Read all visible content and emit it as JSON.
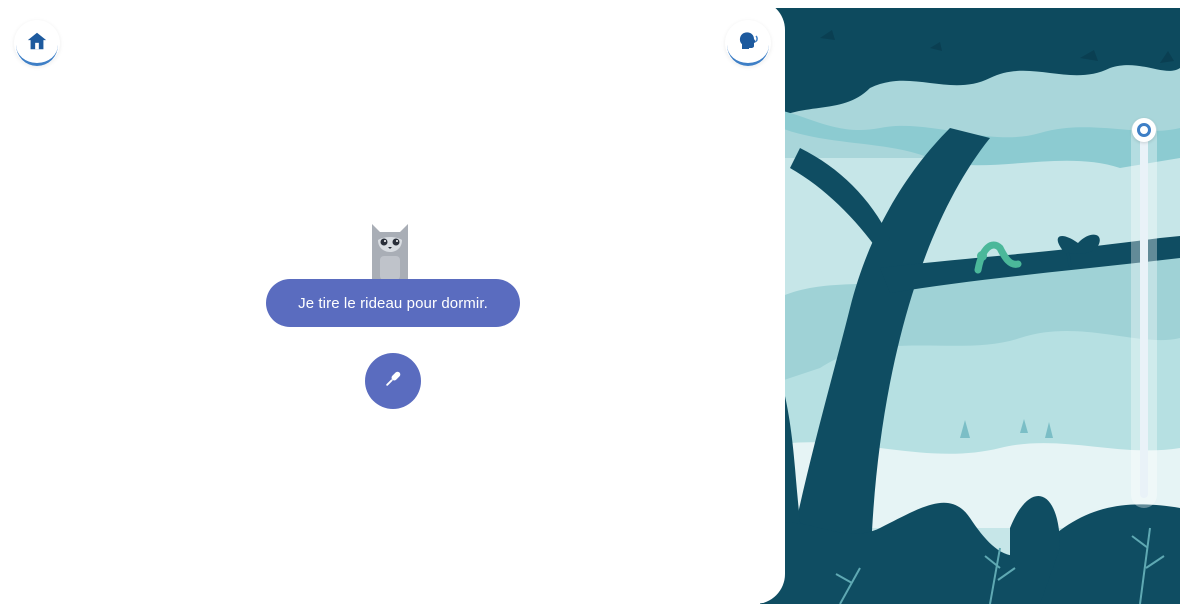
{
  "screen": {
    "sentence": "Je tire le rideau pour dormir."
  },
  "icons": {
    "home": "home-icon",
    "listen": "head-speaking-icon",
    "microphone": "microphone-icon",
    "character": "cat-icon"
  },
  "scroll": {
    "position": 0
  },
  "colors": {
    "accent": "#5a6cbf",
    "arc": "#3e7fc6",
    "scene_dark": "#0d4a5e",
    "scene_light": "#b4dde0"
  }
}
